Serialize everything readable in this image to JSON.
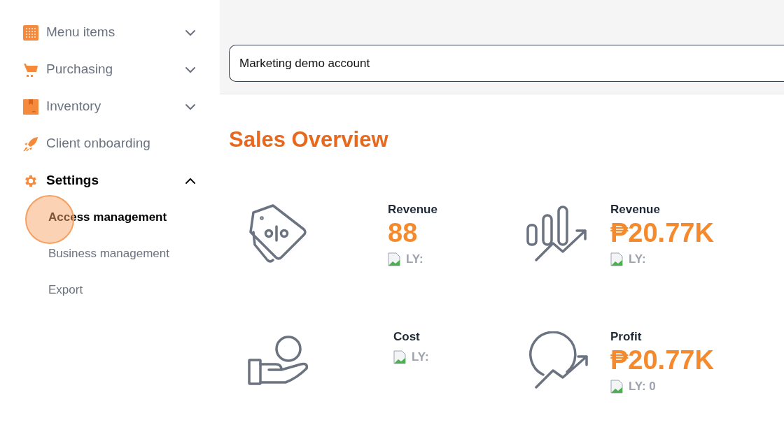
{
  "sidebar": {
    "items": [
      {
        "label": "Menu items",
        "kind": "grid",
        "expandable": true,
        "expanded": false,
        "selected": false
      },
      {
        "label": "Purchasing",
        "kind": "cart",
        "expandable": true,
        "expanded": false,
        "selected": false
      },
      {
        "label": "Inventory",
        "kind": "box",
        "expandable": true,
        "expanded": false,
        "selected": false
      },
      {
        "label": "Client onboarding",
        "kind": "rocket",
        "expandable": false,
        "selected": false
      },
      {
        "label": "Settings",
        "kind": "gear",
        "expandable": true,
        "expanded": true,
        "selected": true,
        "children": [
          {
            "label": "Access management",
            "selected": true
          },
          {
            "label": "Business management",
            "selected": false
          },
          {
            "label": "Export",
            "selected": false
          }
        ]
      }
    ]
  },
  "account_field": {
    "value": "Marketing demo account"
  },
  "title": "Sales Overview",
  "stats": [
    {
      "kind": "tag",
      "label": "Revenue",
      "value": "88",
      "ly": "LY:"
    },
    {
      "kind": "bars",
      "label": "Revenue",
      "value": "₱20.77K",
      "ly": "LY:"
    },
    {
      "kind": "hand",
      "label": "Cost",
      "ly": "LY:"
    },
    {
      "kind": "circle",
      "label": "Profit",
      "value": "₱20.77K",
      "ly": "LY: 0"
    }
  ]
}
